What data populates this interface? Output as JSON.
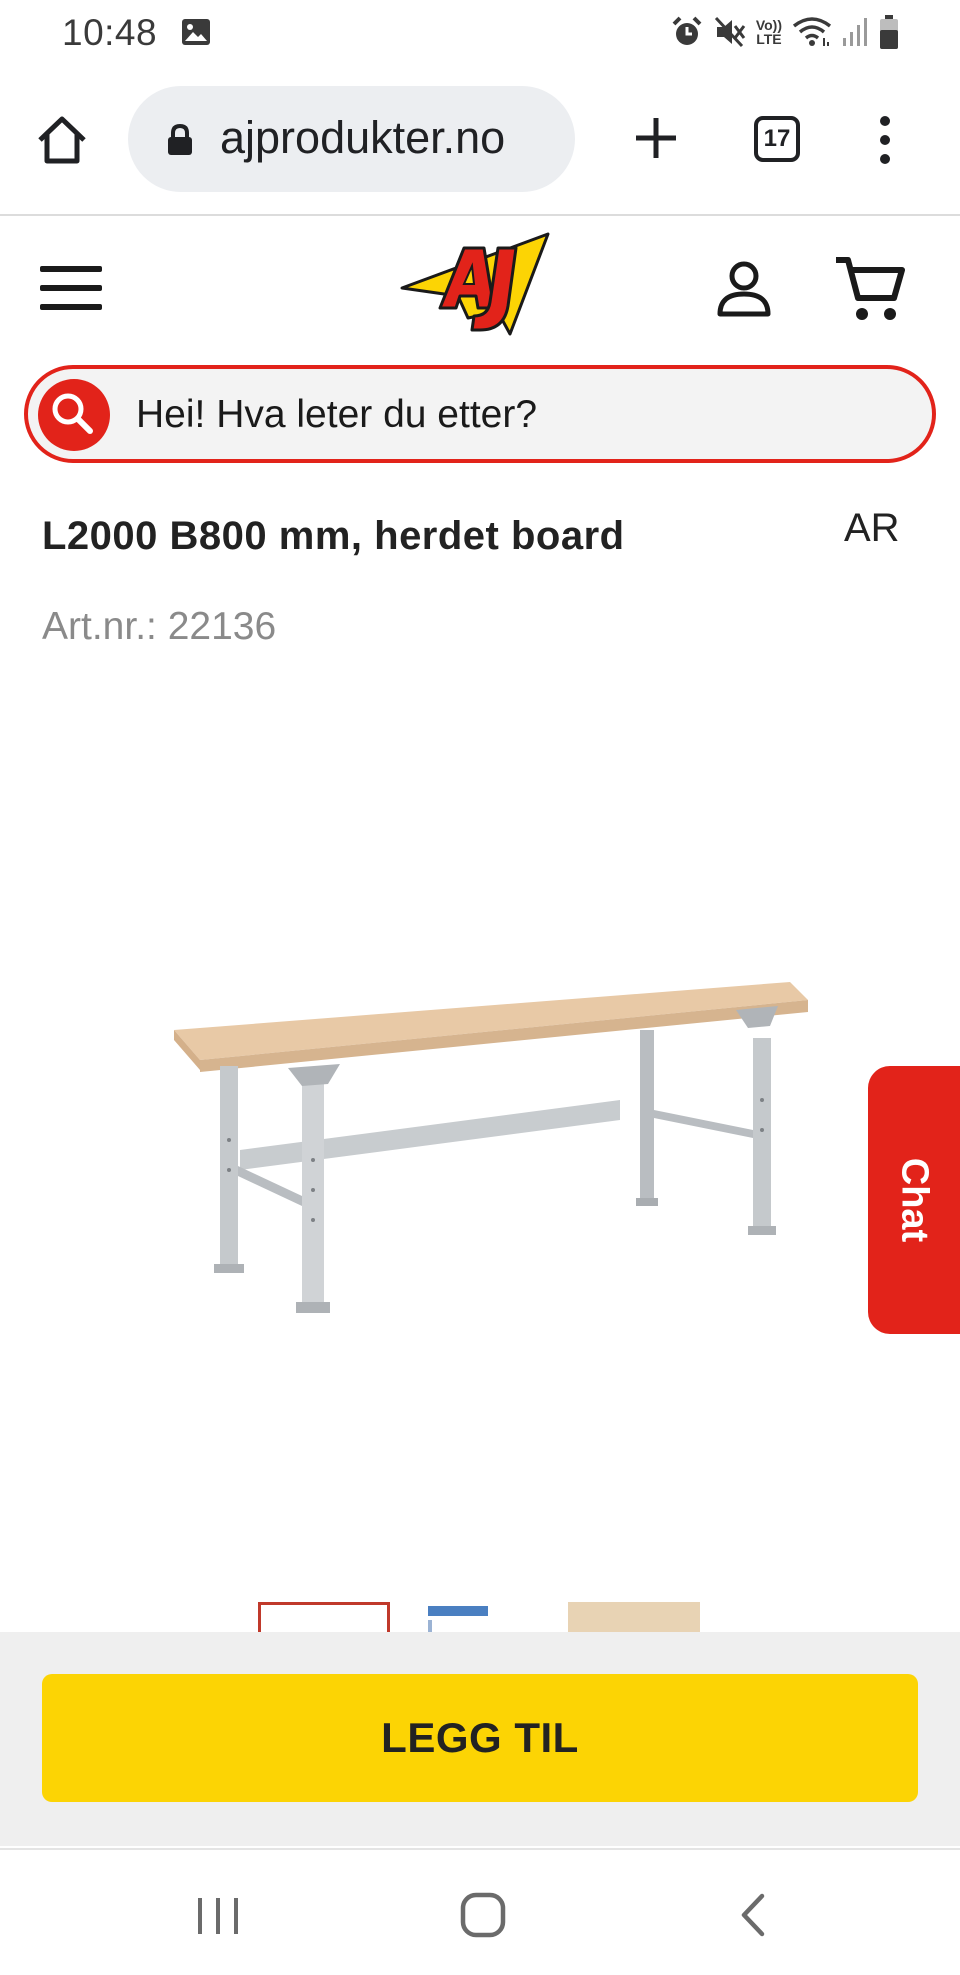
{
  "status_bar": {
    "time": "10:48",
    "network_label_top": "Vo))",
    "network_label_bottom": "LTE",
    "icons": [
      "gallery-icon",
      "alarm-icon",
      "mute-icon",
      "volte-icon",
      "wifi-icon",
      "signal-icon",
      "battery-icon"
    ]
  },
  "browser": {
    "url": "ajprodukter.no",
    "tab_count": "17",
    "icons": [
      "home-icon",
      "lock-icon",
      "new-tab-icon",
      "tabs-icon",
      "more-menu-icon"
    ]
  },
  "site_header": {
    "logo_text": "AJ",
    "icons": [
      "hamburger-menu-icon",
      "account-icon",
      "cart-icon"
    ],
    "colors": {
      "brand_red": "#e2231a",
      "brand_yellow": "#fcd404"
    }
  },
  "search": {
    "placeholder": "Hei! Hva leter du etter?"
  },
  "product": {
    "title": "L2000 B800 mm, herdet board",
    "ar_label": "AR",
    "art_nr": "Art.nr.: 22136",
    "image_alt_icon": "workbench-image"
  },
  "chat": {
    "label": "Chat"
  },
  "cta": {
    "add_label": "LEGG TIL"
  },
  "android_nav": {
    "icons": [
      "recent-apps-icon",
      "home-button-icon",
      "back-icon"
    ]
  }
}
